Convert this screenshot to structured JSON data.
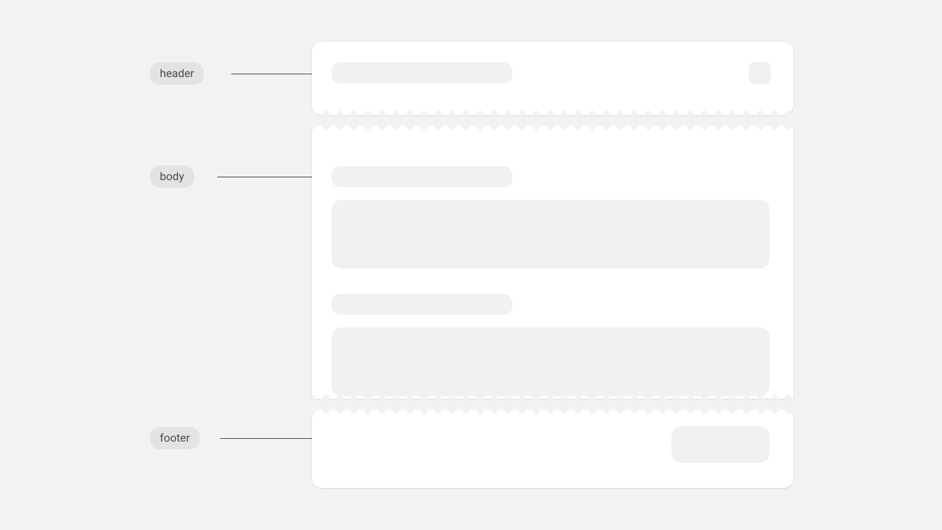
{
  "labels": {
    "header": "header",
    "body": "body",
    "footer": "footer"
  }
}
